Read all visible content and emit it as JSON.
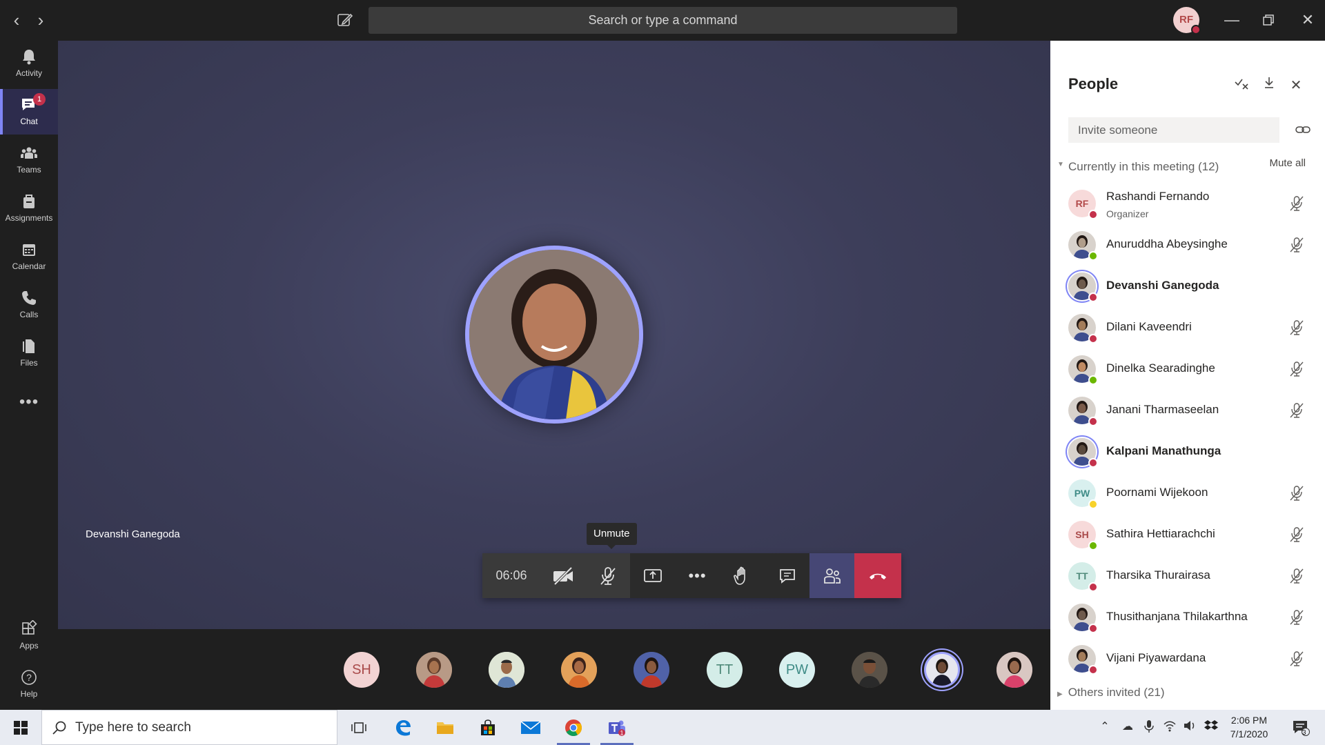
{
  "titlebar": {
    "search_placeholder": "Search or type a command",
    "user_initials": "RF"
  },
  "rail": {
    "items": [
      {
        "label": "Activity",
        "icon": "bell-icon"
      },
      {
        "label": "Chat",
        "icon": "chat-icon",
        "badge": "1",
        "active": true
      },
      {
        "label": "Teams",
        "icon": "teams-icon"
      },
      {
        "label": "Assignments",
        "icon": "assignments-icon"
      },
      {
        "label": "Calendar",
        "icon": "calendar-icon"
      },
      {
        "label": "Calls",
        "icon": "phone-icon"
      },
      {
        "label": "Files",
        "icon": "files-icon"
      }
    ],
    "bottom": [
      {
        "label": "Apps",
        "icon": "apps-icon"
      },
      {
        "label": "Help",
        "icon": "help-icon"
      }
    ]
  },
  "stage": {
    "speaker_name": "Devanshi Ganegoda",
    "tooltip": "Unmute"
  },
  "controls": {
    "timer": "06:06"
  },
  "strip": {
    "thumbnails": [
      {
        "initials": "SH",
        "bg": "#f2d3d3",
        "fg": "#a94a4a"
      },
      {
        "initials": "",
        "photo": true
      },
      {
        "initials": "",
        "photo": true
      },
      {
        "initials": "",
        "photo": true
      },
      {
        "initials": "",
        "photo": true
      },
      {
        "initials": "TT",
        "bg": "#d4ede8",
        "fg": "#4f8a7a"
      },
      {
        "initials": "PW",
        "bg": "#d9f0ef",
        "fg": "#3f8c87"
      },
      {
        "initials": "",
        "photo": true
      },
      {
        "initials": "",
        "photo": true,
        "selected": true
      },
      {
        "initials": "",
        "photo": true
      }
    ]
  },
  "people": {
    "title": "People",
    "invite_placeholder": "Invite someone",
    "section_label": "Currently in this meeting (12)",
    "mute_all": "Mute all",
    "others": "Others invited (21)",
    "members": [
      {
        "name": "Rashandi Fernando",
        "role": "Organizer",
        "initials": "RF",
        "bg": "#f7dada",
        "fg": "#b24a4a",
        "status": "#c4314b",
        "muted": true
      },
      {
        "name": "Anuruddha Abeysinghe",
        "role": "",
        "initials": "",
        "photo": true,
        "status": "#6bb700",
        "muted": true
      },
      {
        "name": "Devanshi Ganegoda",
        "role": "",
        "initials": "",
        "photo": true,
        "status": "#c4314b",
        "muted": false,
        "speaking": true
      },
      {
        "name": "Dilani Kaveendri",
        "role": "",
        "initials": "",
        "photo": true,
        "status": "#c4314b",
        "muted": true
      },
      {
        "name": "Dinelka Searadinghe",
        "role": "",
        "initials": "",
        "photo": true,
        "status": "#6bb700",
        "muted": true
      },
      {
        "name": "Janani Tharmaseelan",
        "role": "",
        "initials": "",
        "photo": true,
        "status": "#c4314b",
        "muted": true
      },
      {
        "name": "Kalpani Manathunga",
        "role": "",
        "initials": "",
        "photo": true,
        "status": "#c4314b",
        "muted": false,
        "speaking": true
      },
      {
        "name": "Poornami Wijekoon",
        "role": "",
        "initials": "PW",
        "bg": "#d9f0ef",
        "fg": "#3f8c87",
        "status": "#f8d22a",
        "muted": true
      },
      {
        "name": "Sathira Hettiarachchi",
        "role": "",
        "initials": "SH",
        "bg": "#f7dada",
        "fg": "#a94a4a",
        "status": "#6bb700",
        "muted": true
      },
      {
        "name": "Tharsika Thurairasa",
        "role": "",
        "initials": "TT",
        "bg": "#d4ede8",
        "fg": "#4f8a7a",
        "status": "#c4314b",
        "muted": true
      },
      {
        "name": "Thusithanjana Thilakarthna",
        "role": "",
        "initials": "",
        "photo": true,
        "status": "#c4314b",
        "muted": true
      },
      {
        "name": "Vijani Piyawardana",
        "role": "",
        "initials": "",
        "photo": true,
        "status": "#c4314b",
        "muted": true
      }
    ]
  },
  "taskbar": {
    "search_placeholder": "Type here to search",
    "time": "2:06 PM",
    "date": "7/1/2020",
    "notification_count": "3"
  }
}
